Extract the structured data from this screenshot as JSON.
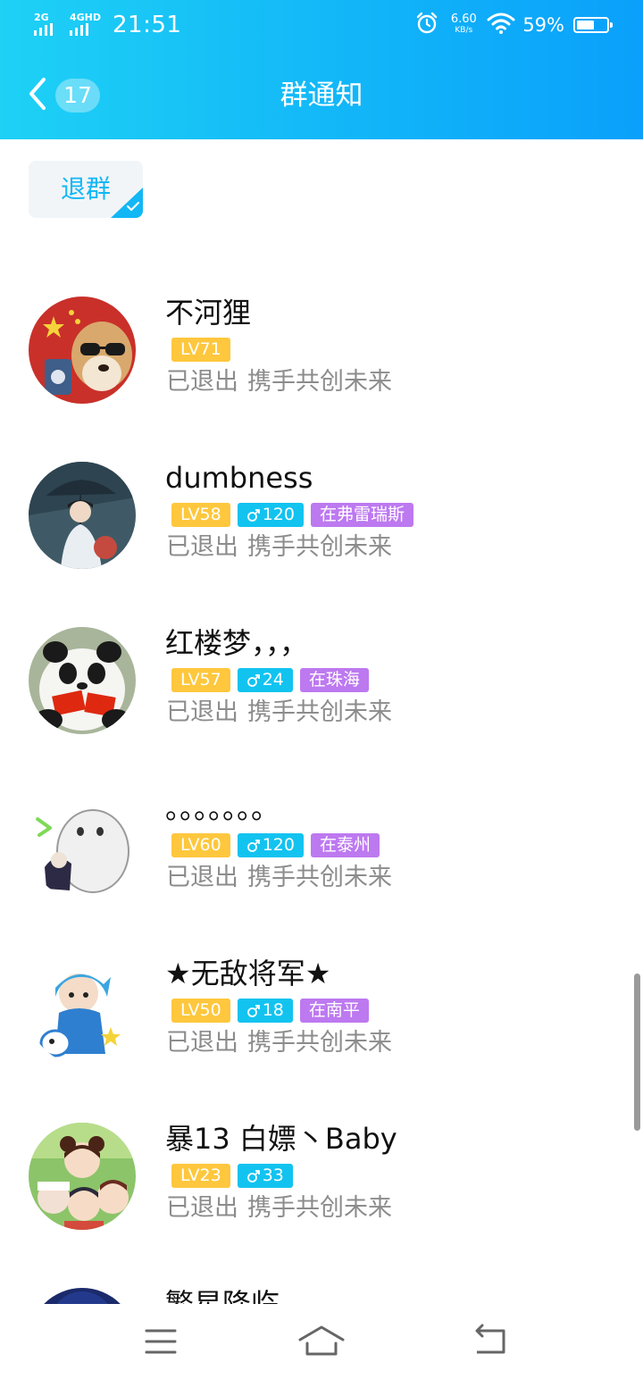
{
  "status_bar": {
    "network_1": "2G",
    "network_2": "4GHD",
    "time": "21:51",
    "net_speed": "6.60",
    "net_speed_unit": "KB/s",
    "battery": "59%",
    "battery_level": 0.59,
    "icons": [
      "alarm-icon",
      "wifi-icon",
      "battery-icon"
    ]
  },
  "header": {
    "back_icon": "chevron-left-icon",
    "back_count": "17",
    "title": "群通知"
  },
  "filter_tag": {
    "label": "退群",
    "selected": true
  },
  "members": [
    {
      "name": "不河狸",
      "level": "LV71",
      "age": "",
      "location": "",
      "status": "已退出",
      "reason": "携手共创未来",
      "avatar": "avatar-dog-flag"
    },
    {
      "name": "dumbness",
      "level": "LV58",
      "age": "120",
      "location": "在弗雷瑞斯",
      "status": "已退出",
      "reason": "携手共创未来",
      "avatar": "avatar-umbrella-boy"
    },
    {
      "name": "红楼梦，，，",
      "level": "LV57",
      "age": "24",
      "location": "在珠海",
      "status": "已退出",
      "reason": "携手共创未来",
      "avatar": "avatar-panda-flags"
    },
    {
      "name": "。。。。。。。",
      "level": "LV60",
      "age": "120",
      "location": "在泰州",
      "status": "已退出",
      "reason": "携手共创未来",
      "avatar": "avatar-ghost-sketch"
    },
    {
      "name": "★无敌将军★",
      "level": "LV50",
      "age": "18",
      "location": "在南平",
      "status": "已退出",
      "reason": "携手共创未来",
      "avatar": "avatar-anime-blue"
    },
    {
      "name": "暴13  白嫖丶Baby",
      "level": "LV23",
      "age": "33",
      "location": "",
      "status": "已退出",
      "reason": "携手共创未来",
      "avatar": "avatar-anime-group"
    },
    {
      "name": "繁星降临",
      "level": "",
      "age": "",
      "location": "",
      "status": "",
      "reason": "",
      "avatar": "avatar-night"
    }
  ],
  "nav_bar": {
    "icons": [
      "menu-icon",
      "home-icon",
      "back-icon"
    ]
  },
  "colors": {
    "header_start": "#1ed1f5",
    "header_end": "#0aa0fb",
    "accent": "#12b7f5",
    "level_badge": "#fec73d",
    "age_badge": "#12c3f0",
    "location_badge": "#bd79f0",
    "status_text": "#8c8c8c"
  }
}
